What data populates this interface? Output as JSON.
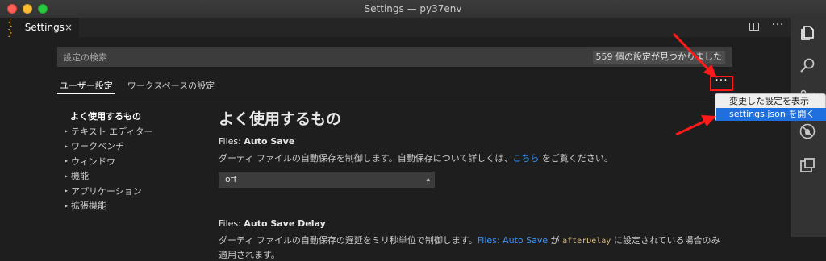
{
  "window": {
    "title": "Settings — py37env"
  },
  "tab": {
    "icon_glyph": "{ }",
    "label": "Settings",
    "close_glyph": "×"
  },
  "editor_actions": {
    "more_glyph": "···"
  },
  "search": {
    "placeholder": "設定の検索",
    "result_count": "559 個の設定が見つかりました"
  },
  "scope_tabs": [
    {
      "label": "ユーザー設定",
      "active": true
    },
    {
      "label": "ワークスペースの設定",
      "active": false
    }
  ],
  "more_actions": {
    "glyph": "···",
    "highlight_color": "#ff1a1a"
  },
  "toc": {
    "items": [
      {
        "label": "よく使用するもの",
        "expandable": false
      },
      {
        "label": "テキスト エディター",
        "expandable": true
      },
      {
        "label": "ワークベンチ",
        "expandable": true
      },
      {
        "label": "ウィンドウ",
        "expandable": true
      },
      {
        "label": "機能",
        "expandable": true
      },
      {
        "label": "アプリケーション",
        "expandable": true
      },
      {
        "label": "拡張機能",
        "expandable": true
      }
    ]
  },
  "content": {
    "section_title": "よく使用するもの",
    "settings": [
      {
        "category": "Files: ",
        "name": "Auto Save",
        "desc_before": "ダーティ ファイルの自動保存を制御します。自動保存について詳しくは、",
        "desc_link": "こちら",
        "desc_after": " をご覧ください。",
        "value": "off"
      },
      {
        "category": "Files: ",
        "name": "Auto Save Delay",
        "desc_before": "ダーティ ファイルの自動保存の遅延をミリ秒単位で制御します。",
        "desc_link": "Files: Auto Save",
        "desc_mid": " が ",
        "desc_code": "afterDelay",
        "desc_after": " に設定されている場合のみ",
        "desc_line2": "適用されます。"
      }
    ]
  },
  "context_menu": {
    "items": [
      {
        "label": "変更した設定を表示",
        "selected": false
      },
      {
        "label": "settings.json を開く",
        "selected": true
      }
    ]
  },
  "activity_bar": {
    "icons": [
      "explorer-icon",
      "search-icon",
      "source-control-icon",
      "debug-icon",
      "extensions-icon"
    ]
  },
  "colors": {
    "accent_link": "#3794ff",
    "menu_selection": "#1f6fdf",
    "annotation_red": "#ff1a1a"
  }
}
